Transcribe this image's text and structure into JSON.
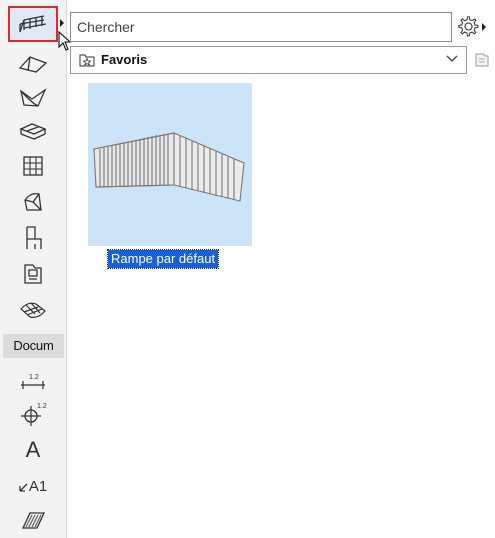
{
  "toolbox": {
    "tools": [
      {
        "name": "railing-tool",
        "icon": "railing-icon"
      },
      {
        "name": "roof-tool",
        "icon": "roof-icon"
      },
      {
        "name": "shell-tool",
        "icon": "shell-icon"
      },
      {
        "name": "stair-tool",
        "icon": "stair-icon"
      },
      {
        "name": "curtain-wall-tool",
        "icon": "curtain-wall-icon"
      },
      {
        "name": "morph-tool",
        "icon": "morph-icon"
      },
      {
        "name": "object-tool",
        "icon": "chair-icon"
      },
      {
        "name": "zone-tool",
        "icon": "zone-icon"
      },
      {
        "name": "mesh-tool",
        "icon": "mesh-icon"
      }
    ],
    "section_label": "Docum",
    "doc_tools": [
      {
        "name": "dimension-tool",
        "icon": "dimension-icon"
      },
      {
        "name": "level-dimension-tool",
        "icon": "level-dimension-icon"
      },
      {
        "name": "text-tool",
        "icon": "text-icon",
        "glyph": "A"
      },
      {
        "name": "label-tool",
        "icon": "label-icon",
        "glyph": "A1"
      },
      {
        "name": "fill-tool",
        "icon": "fill-icon"
      }
    ],
    "dimension_value": "1.2",
    "level_value": "1.2"
  },
  "search": {
    "placeholder": "Chercher",
    "value": ""
  },
  "favorites": {
    "label": "Favoris"
  },
  "content": {
    "item_label": "Rampe par défaut"
  },
  "colors": {
    "selection_border": "#e02b2b",
    "thumb_bg": "#cce4f7",
    "label_bg": "#1b5fd6"
  }
}
